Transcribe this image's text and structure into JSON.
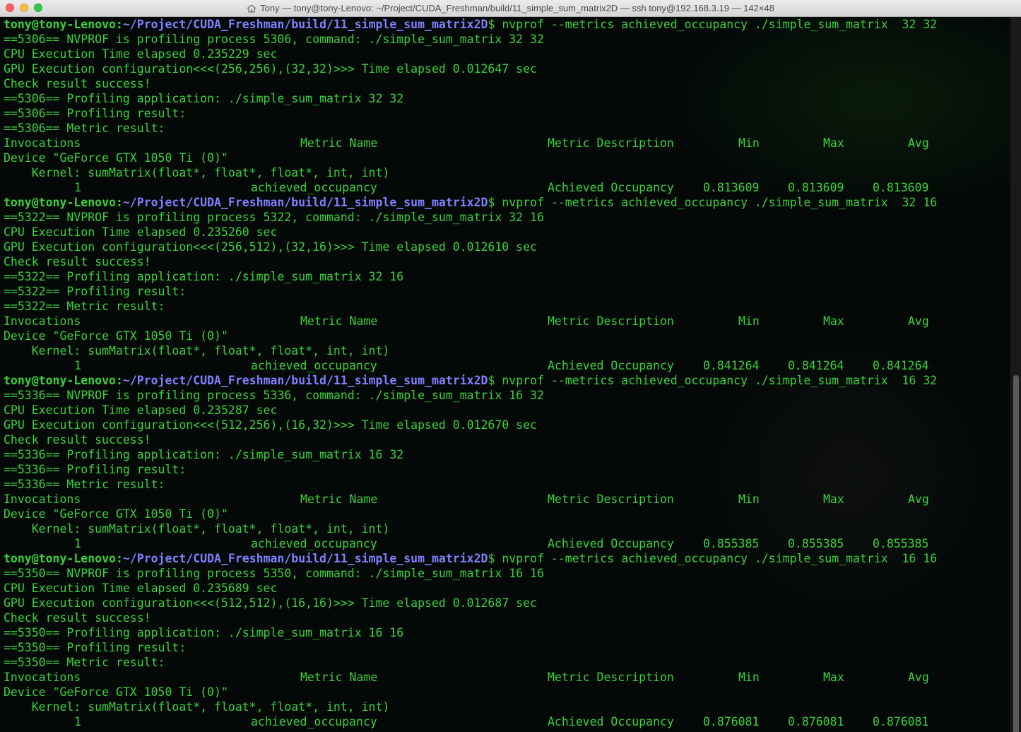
{
  "window": {
    "title": "Tony — tony@tony-Lenovo: ~/Project/CUDA_Freshman/build/11_simple_sum_matrix2D — ssh tony@192.168.3.19 — 142×48"
  },
  "colors": {
    "text": "#3ad13a",
    "path": "#8080ff",
    "background": "#040907"
  },
  "prompt": {
    "user": "tony@tony-Lenovo",
    "colon": ":",
    "path": "~/Project/CUDA_Freshman/build/11_simple_sum_matrix2D",
    "dollar": "$"
  },
  "header": {
    "invocations": "Invocations",
    "metric_name": "Metric Name",
    "metric_description": "Metric Description",
    "min": "Min",
    "max": "Max",
    "avg": "Avg"
  },
  "runs": [
    {
      "command": " nvprof --metrics achieved_occupancy ./simple_sum_matrix  32 32",
      "profiling_process": "==5306== NVPROF is profiling process 5306, command: ./simple_sum_matrix 32 32",
      "cpu_time": "CPU Execution Time elapsed 0.235229 sec",
      "gpu_config": "GPU Execution configuration<<<(256,256),(32,32)>>> Time elapsed 0.012647 sec",
      "check": "Check result success!",
      "profiling_app": "==5306== Profiling application: ./simple_sum_matrix 32 32",
      "profiling_result": "==5306== Profiling result:",
      "metric_result": "==5306== Metric result:",
      "device": "Device \"GeForce GTX 1050 Ti (0)\"",
      "kernel": "    Kernel: sumMatrix(float*, float*, float*, int, int)",
      "invocations": "1",
      "metric_name": "achieved_occupancy",
      "metric_description": "Achieved Occupancy",
      "min": "0.813609",
      "max": "0.813609",
      "avg": "0.813609"
    },
    {
      "command": " nvprof --metrics achieved_occupancy ./simple_sum_matrix  32 16",
      "profiling_process": "==5322== NVPROF is profiling process 5322, command: ./simple_sum_matrix 32 16",
      "cpu_time": "CPU Execution Time elapsed 0.235260 sec",
      "gpu_config": "GPU Execution configuration<<<(256,512),(32,16)>>> Time elapsed 0.012610 sec",
      "check": "Check result success!",
      "profiling_app": "==5322== Profiling application: ./simple_sum_matrix 32 16",
      "profiling_result": "==5322== Profiling result:",
      "metric_result": "==5322== Metric result:",
      "device": "Device \"GeForce GTX 1050 Ti (0)\"",
      "kernel": "    Kernel: sumMatrix(float*, float*, float*, int, int)",
      "invocations": "1",
      "metric_name": "achieved_occupancy",
      "metric_description": "Achieved Occupancy",
      "min": "0.841264",
      "max": "0.841264",
      "avg": "0.841264"
    },
    {
      "command": " nvprof --metrics achieved_occupancy ./simple_sum_matrix  16 32",
      "profiling_process": "==5336== NVPROF is profiling process 5336, command: ./simple_sum_matrix 16 32",
      "cpu_time": "CPU Execution Time elapsed 0.235287 sec",
      "gpu_config": "GPU Execution configuration<<<(512,256),(16,32)>>> Time elapsed 0.012670 sec",
      "check": "Check result success!",
      "profiling_app": "==5336== Profiling application: ./simple_sum_matrix 16 32",
      "profiling_result": "==5336== Profiling result:",
      "metric_result": "==5336== Metric result:",
      "device": "Device \"GeForce GTX 1050 Ti (0)\"",
      "kernel": "    Kernel: sumMatrix(float*, float*, float*, int, int)",
      "invocations": "1",
      "metric_name": "achieved_occupancy",
      "metric_description": "Achieved Occupancy",
      "min": "0.855385",
      "max": "0.855385",
      "avg": "0.855385"
    },
    {
      "command": " nvprof --metrics achieved_occupancy ./simple_sum_matrix  16 16",
      "profiling_process": "==5350== NVPROF is profiling process 5350, command: ./simple_sum_matrix 16 16",
      "cpu_time": "CPU Execution Time elapsed 0.235689 sec",
      "gpu_config": "GPU Execution configuration<<<(512,512),(16,16)>>> Time elapsed 0.012687 sec",
      "check": "Check result success!",
      "profiling_app": "==5350== Profiling application: ./simple_sum_matrix 16 16",
      "profiling_result": "==5350== Profiling result:",
      "metric_result": "==5350== Metric result:",
      "device": "Device \"GeForce GTX 1050 Ti (0)\"",
      "kernel": "    Kernel: sumMatrix(float*, float*, float*, int, int)",
      "invocations": "1",
      "metric_name": "achieved_occupancy",
      "metric_description": "Achieved Occupancy",
      "min": "0.876081",
      "max": "0.876081",
      "avg": "0.876081"
    }
  ]
}
